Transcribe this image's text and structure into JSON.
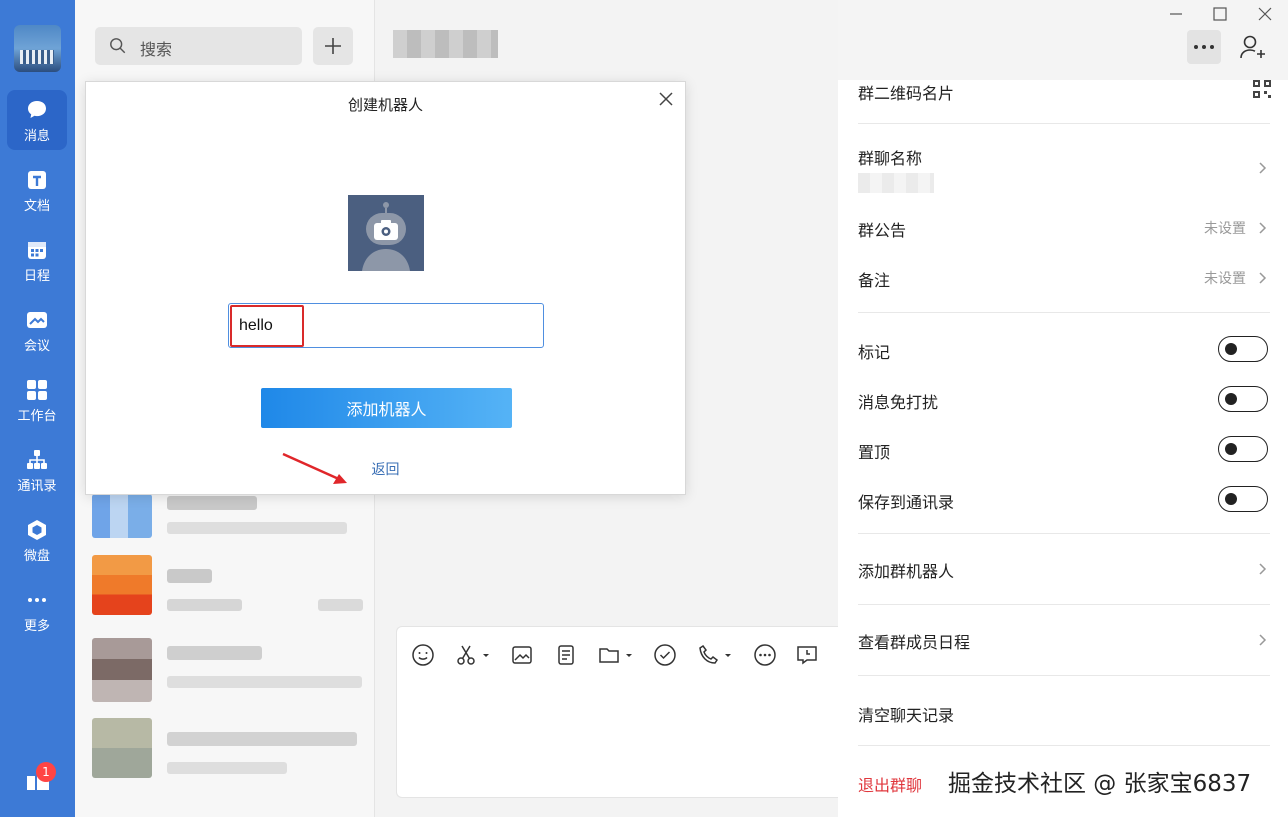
{
  "nav": {
    "items": [
      {
        "label": "消息",
        "icon": "message-icon"
      },
      {
        "label": "文档",
        "icon": "document-icon"
      },
      {
        "label": "日程",
        "icon": "calendar-icon"
      },
      {
        "label": "会议",
        "icon": "meeting-icon"
      },
      {
        "label": "工作台",
        "icon": "workbench-icon"
      },
      {
        "label": "通讯录",
        "icon": "contacts-icon"
      },
      {
        "label": "微盘",
        "icon": "drive-icon"
      },
      {
        "label": "更多",
        "icon": "more-icon"
      }
    ],
    "badge_count": "1"
  },
  "search": {
    "placeholder": "搜索"
  },
  "dialog": {
    "title": "创建机器人",
    "name_value": "hello",
    "add_button_label": "添加机器人",
    "back_label": "返回"
  },
  "panel": {
    "qr_label": "群二维码名片",
    "group_name_label": "群聊名称",
    "announcement_label": "群公告",
    "announcement_value": "未设置",
    "remark_label": "备注",
    "remark_value": "未设置",
    "toggles": [
      {
        "label": "标记",
        "on": false
      },
      {
        "label": "消息免打扰",
        "on": false
      },
      {
        "label": "置顶",
        "on": false
      },
      {
        "label": "保存到通讯录",
        "on": false
      }
    ],
    "add_robot_label": "添加群机器人",
    "member_schedule_label": "查看群成员日程",
    "clear_history_label": "清空聊天记录",
    "exit_label": "退出群聊"
  },
  "watermark_text": "掘金技术社区 @ 张家宝6837",
  "colors": {
    "nav_bg": "#3d7ad6",
    "accent": "#1f88e8",
    "danger": "#e0383e"
  }
}
